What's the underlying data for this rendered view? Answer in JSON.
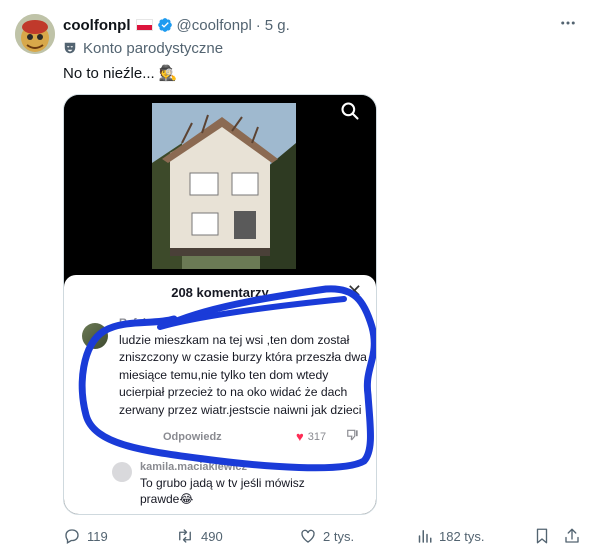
{
  "author": {
    "display_name": "coolfonpl",
    "handle": "@coolfonpl",
    "separator": "·",
    "time": "5 g.",
    "label": "Konto parodystyczne"
  },
  "tweet": {
    "text": "No to nieźle...",
    "emoji": "🕵"
  },
  "media": {
    "sheet_title": "208 komentarzy",
    "close_glyph": "✕",
    "comments": [
      {
        "user": "Rafał",
        "text": "ludzie mieszkam na tej wsi ,ten dom został zniszczony w czasie burzy która przeszła dwa miesiące temu,nie tylko ten dom wtedy ucierpiał przecież to na oko widać że dach zerwany przez wiatr.jestscie naiwni jak dzieci",
        "reply_label": "Odpowiedz",
        "likes": "317"
      },
      {
        "user": "kamila.maciakiewicz",
        "text": "To grubo jadą w tv jeśli mówisz prawde😂"
      }
    ]
  },
  "actions": {
    "replies": "119",
    "retweets": "490",
    "likes": "2 tys.",
    "views": "182 tys."
  },
  "colors": {
    "text": "#0f1419",
    "secondary": "#536471",
    "verified": "#1d9bf0",
    "scribble": "#1a3bd8",
    "heart": "#fe2c55"
  }
}
